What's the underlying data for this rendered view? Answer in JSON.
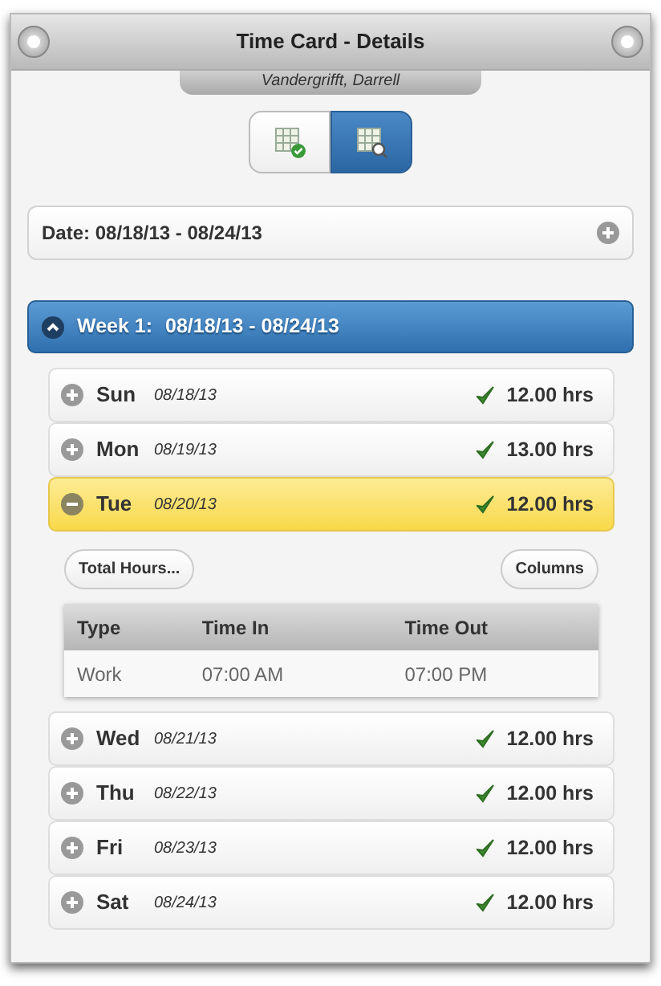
{
  "header": {
    "title": "Time Card - Details",
    "subtitle": "Vandergrifft, Darrell"
  },
  "view_toggle": [
    {
      "kind": "approved",
      "selected": false
    },
    {
      "kind": "search",
      "selected": true
    }
  ],
  "date_range": {
    "label": "Date: 08/18/13 - 08/24/13"
  },
  "week": {
    "label": "Week 1:",
    "range": "08/18/13 - 08/24/13",
    "expanded": true
  },
  "days": [
    {
      "day": "Sun",
      "date": "08/18/13",
      "hours": "12.00 hrs",
      "approved": true,
      "expanded": false
    },
    {
      "day": "Mon",
      "date": "08/19/13",
      "hours": "13.00 hrs",
      "approved": true,
      "expanded": false
    },
    {
      "day": "Tue",
      "date": "08/20/13",
      "hours": "12.00 hrs",
      "approved": true,
      "expanded": true,
      "detail": {
        "buttons": [
          "Total Hours...",
          "Columns"
        ],
        "columns": [
          "Type",
          "Time In",
          "Time Out"
        ],
        "rows": [
          [
            "Work",
            "07:00 AM",
            "07:00 PM"
          ]
        ]
      }
    },
    {
      "day": "Wed",
      "date": "08/21/13",
      "hours": "12.00 hrs",
      "approved": true,
      "expanded": false
    },
    {
      "day": "Thu",
      "date": "08/22/13",
      "hours": "12.00 hrs",
      "approved": true,
      "expanded": false
    },
    {
      "day": "Fri",
      "date": "08/23/13",
      "hours": "12.00 hrs",
      "approved": true,
      "expanded": false
    },
    {
      "day": "Sat",
      "date": "08/24/13",
      "hours": "12.00 hrs",
      "approved": true,
      "expanded": false
    }
  ]
}
